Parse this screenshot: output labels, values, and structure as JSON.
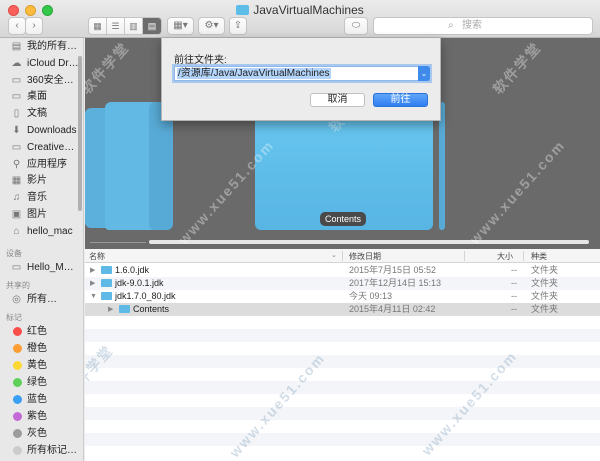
{
  "window": {
    "title": "JavaVirtualMachines"
  },
  "toolbar": {
    "back": "‹",
    "forward": "›",
    "views": [
      "▦",
      "☰",
      "▥",
      "▤"
    ],
    "arrange": "▦▾",
    "action": "⚙▾",
    "share": "⇪",
    "tag": "⬭",
    "search_placeholder": "搜索"
  },
  "sidebar": {
    "favorites": [
      {
        "label": "我的所有…",
        "icon": "all-files-icon"
      },
      {
        "label": "iCloud Dr…",
        "icon": "cloud-icon"
      },
      {
        "label": "360安全…",
        "icon": "folder-icon"
      },
      {
        "label": "桌面",
        "icon": "desktop-icon"
      },
      {
        "label": "文稿",
        "icon": "document-icon"
      },
      {
        "label": "Downloads",
        "icon": "download-icon"
      },
      {
        "label": "Creative…",
        "icon": "folder-icon"
      },
      {
        "label": "应用程序",
        "icon": "applications-icon"
      },
      {
        "label": "影片",
        "icon": "film-icon"
      },
      {
        "label": "音乐",
        "icon": "music-icon"
      },
      {
        "label": "图片",
        "icon": "camera-icon"
      },
      {
        "label": "hello_mac",
        "icon": "home-icon"
      }
    ],
    "devices_header": "设备",
    "devices": [
      {
        "label": "Hello_M…",
        "icon": "computer-icon"
      }
    ],
    "shared_header": "共享的",
    "shared": [
      {
        "label": "所有…",
        "icon": "network-icon"
      }
    ],
    "tags_header": "标记",
    "tags": [
      {
        "label": "红色",
        "color": "#fc4f4a"
      },
      {
        "label": "橙色",
        "color": "#fd9d33"
      },
      {
        "label": "黄色",
        "color": "#fdd835"
      },
      {
        "label": "绿色",
        "color": "#5fd05a"
      },
      {
        "label": "蓝色",
        "color": "#3a9ff5"
      },
      {
        "label": "紫色",
        "color": "#c36ad6"
      },
      {
        "label": "灰色",
        "color": "#9c9c9c"
      },
      {
        "label": "所有标记…",
        "color": "#cccccc"
      }
    ]
  },
  "preview": {
    "selected_label": "Contents"
  },
  "dialog": {
    "title": "前往文件夹:",
    "path": "/资源库/Java/JavaVirtualMachines",
    "cancel": "取消",
    "go": "前往"
  },
  "watermarks": [
    "软件学堂",
    "www.xue51.com"
  ],
  "list": {
    "columns": {
      "name": "名称",
      "date": "修改日期",
      "size": "大小",
      "kind": "种类"
    },
    "rows": [
      {
        "name": "1.6.0.jdk",
        "date": "2015年7月15日 05:52",
        "size": "--",
        "kind": "文件夹",
        "disclosure": "▶"
      },
      {
        "name": "jdk-9.0.1.jdk",
        "date": "2017年12月14日 15:13",
        "size": "--",
        "kind": "文件夹",
        "disclosure": "▶"
      },
      {
        "name": "jdk1.7.0_80.jdk",
        "date": "今天 09:13",
        "size": "--",
        "kind": "文件夹",
        "disclosure": "▼"
      },
      {
        "name": "Contents",
        "date": "2015年4月11日 02:42",
        "size": "--",
        "kind": "文件夹",
        "disclosure": "▶"
      }
    ]
  }
}
